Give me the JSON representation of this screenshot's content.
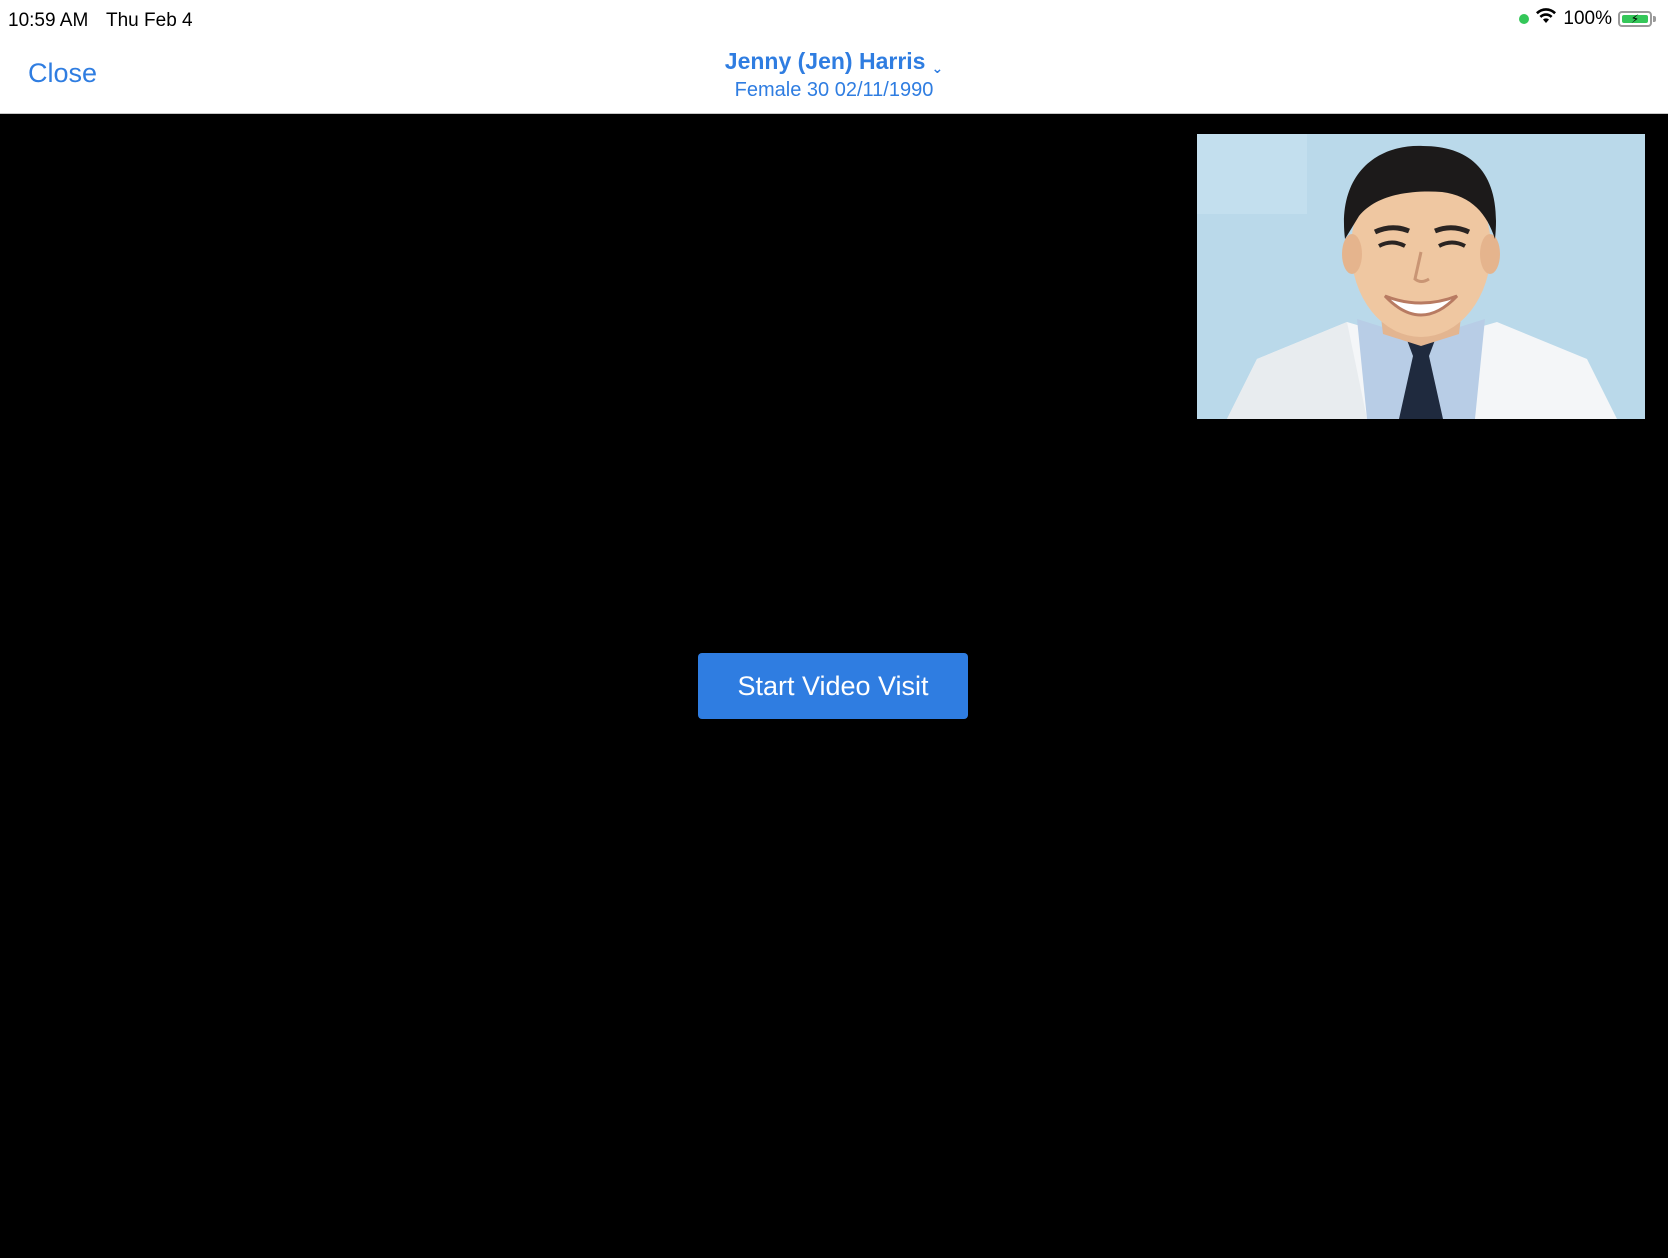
{
  "status_bar": {
    "time": "10:59 AM",
    "date": "Thu Feb 4",
    "battery": "100%"
  },
  "nav": {
    "close_label": "Close",
    "patient_name": "Jenny (Jen) Harris",
    "patient_meta": "Female 30 02/11/1990"
  },
  "video": {
    "start_label": "Start Video Visit"
  },
  "colors": {
    "accent": "#2f7de1",
    "video_background": "#000000",
    "battery_green": "#34c759"
  }
}
